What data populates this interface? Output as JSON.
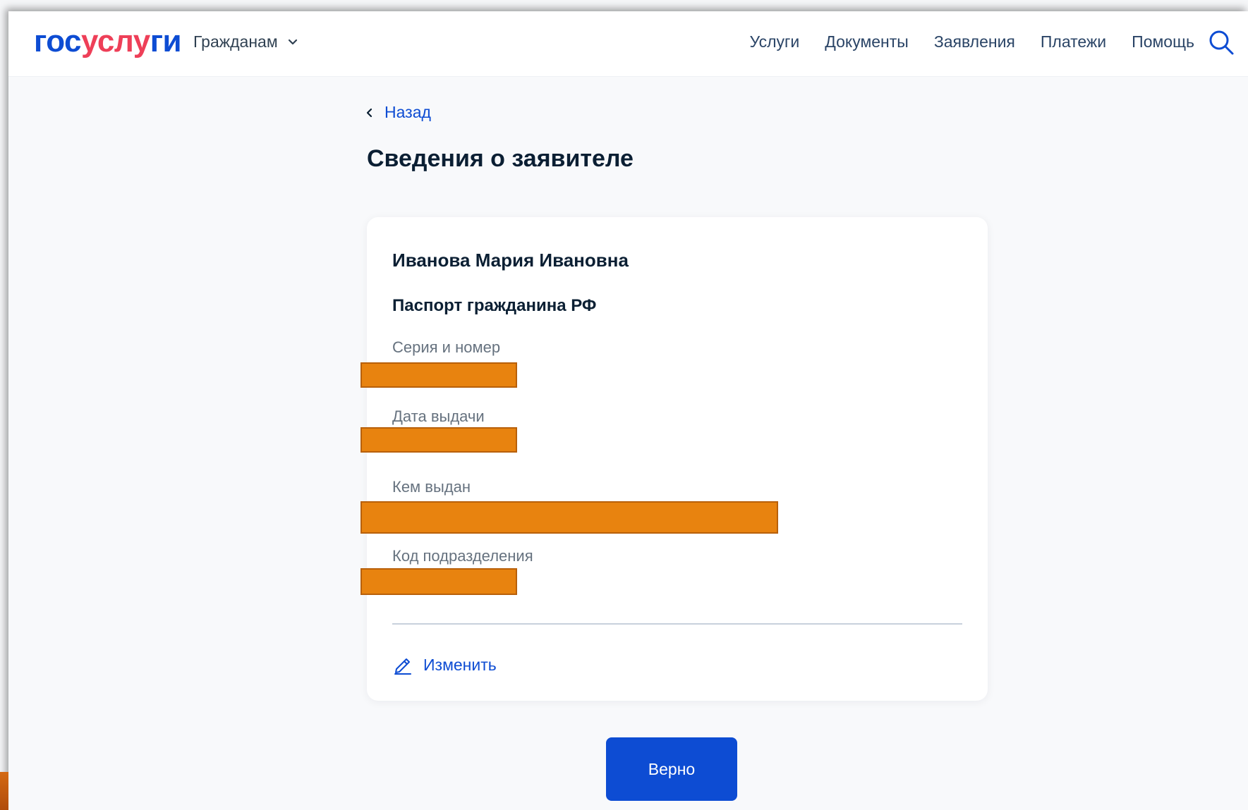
{
  "header": {
    "logo": {
      "part1": "гос",
      "part2": "услу",
      "part3": "ги"
    },
    "citizens_menu": "Гражданам",
    "nav": [
      "Услуги",
      "Документы",
      "Заявления",
      "Платежи",
      "Помощь"
    ]
  },
  "content": {
    "back_label": "Назад",
    "title": "Сведения о заявителе"
  },
  "card": {
    "name": "Иванова Мария Ивановна",
    "document_type": "Паспорт гражданина РФ",
    "fields": [
      {
        "label": "Серия и номер"
      },
      {
        "label": "Дата выдачи"
      },
      {
        "label": "Кем выдан"
      },
      {
        "label": "Код подразделения"
      }
    ],
    "edit_label": "Изменить"
  },
  "actions": {
    "confirm_label": "Верно"
  },
  "colors": {
    "brand_blue": "#0d4cd3",
    "brand_red": "#ee3f58",
    "redaction": "#e8830f"
  },
  "icons": [
    "chevron-down-icon",
    "search-icon",
    "chevron-left-icon",
    "pencil-icon"
  ]
}
